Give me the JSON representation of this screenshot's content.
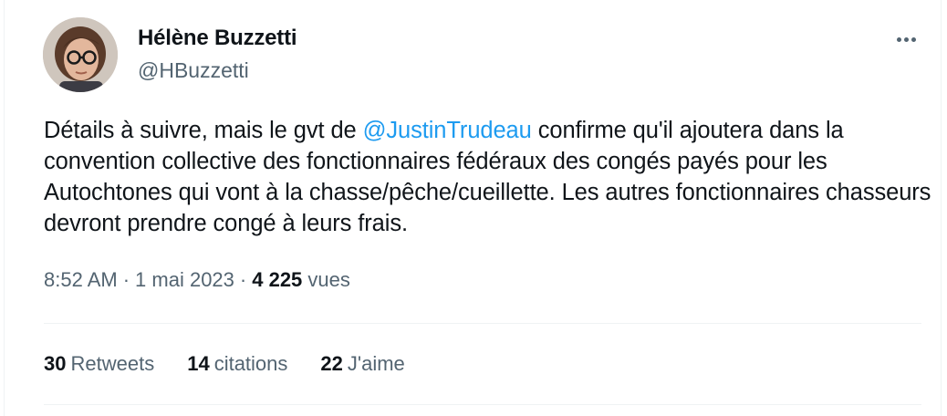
{
  "tweet": {
    "author_name": "Hélène Buzzetti",
    "handle": "@HBuzzetti",
    "text_before": "Détails à suivre, mais le gvt de ",
    "mention": "@JustinTrudeau",
    "text_after": " confirme qu'il ajoutera dans la convention collective des fonctionnaires fédéraux des congés payés pour les Autochtones qui vont à la chasse/pêche/cueillette. Les autres fonctionnaires chasseurs  devront prendre congé à leurs frais.",
    "time": "8:52 AM",
    "date": "1 mai 2023",
    "views_count": "4 225",
    "views_label": "vues",
    "separator": "·"
  },
  "stats": {
    "retweets_count": "30",
    "retweets_label": "Retweets",
    "quotes_count": "14",
    "quotes_label": "citations",
    "likes_count": "22",
    "likes_label": "J'aime"
  },
  "icons": {
    "more": "more-horizontal-icon"
  },
  "colors": {
    "link": "#1d9bf0",
    "secondary_text": "#536471",
    "primary_text": "#0f1419",
    "divider": "#eff3f4"
  }
}
